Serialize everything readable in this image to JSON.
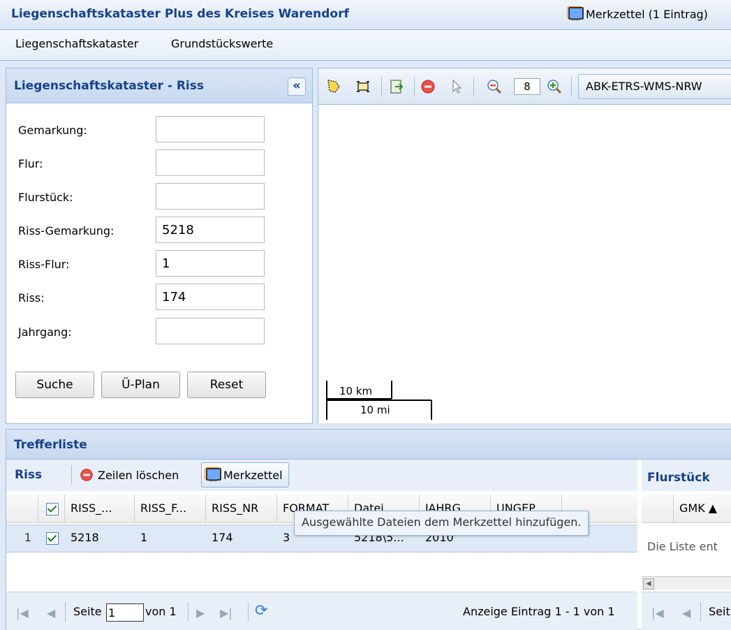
{
  "header": {
    "title": "Liegenschaftskataster Plus des Kreises Warendorf",
    "merkzettel_label": "Merkzettel (1 Eintrag)"
  },
  "menu": {
    "items": [
      "Liegenschaftskataster",
      "Grundstückswerte"
    ]
  },
  "left_panel": {
    "title": "Liegenschaftskataster - Riss",
    "collapse_glyph": "«",
    "fields": [
      {
        "label": "Gemarkung:",
        "value": ""
      },
      {
        "label": "Flur:",
        "value": ""
      },
      {
        "label": "Flurstück:",
        "value": ""
      },
      {
        "label": "Riss-Gemarkung:",
        "value": "5218"
      },
      {
        "label": "Riss-Flur:",
        "value": "1"
      },
      {
        "label": "Riss:",
        "value": "174"
      },
      {
        "label": "Jahrgang:",
        "value": ""
      }
    ],
    "buttons": {
      "search": "Suche",
      "overview": "Ü-Plan",
      "reset": "Reset"
    }
  },
  "map": {
    "zoom_level": "8",
    "layer": "ABK-ETRS-WMS-NRW",
    "scale": {
      "km": "10 km",
      "mi": "10 mi"
    }
  },
  "results": {
    "title": "Trefferliste",
    "riss_grid": {
      "label": "Riss",
      "delete_rows": "Zeilen löschen",
      "merkzettel": "Merkzettel",
      "tooltip": "Ausgewählte Dateien dem Merkzettel hinzufügen.",
      "columns": [
        "RISS_...",
        "RISS_F...",
        "RISS_NR",
        "FORMAT",
        "Datei...",
        "JAHRG...",
        "UNGEP..."
      ],
      "rows": [
        {
          "num": "1",
          "riss_gmk": "5218",
          "riss_flur": "1",
          "riss_nr": "174",
          "format": "3",
          "datei": "5218\\5...",
          "jahrgang": "2010",
          "ungep": ""
        }
      ],
      "pager": {
        "page_label": "Seite",
        "page_value": "1",
        "of_label": "von 1",
        "status": "Anzeige Eintrag 1 - 1 von 1"
      }
    },
    "flurstueck_grid": {
      "label": "Flurstück",
      "column": "GMK ▲",
      "empty_text": "Die Liste ent",
      "page_label": "Seit"
    }
  }
}
